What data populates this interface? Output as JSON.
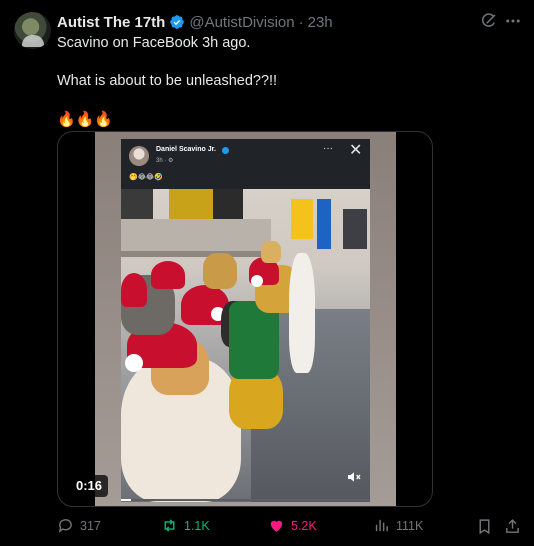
{
  "author": {
    "display_name": "Autist The 17th",
    "handle": "@AutistDivision",
    "separator": "·",
    "time": "23h",
    "verified": true
  },
  "tweet": {
    "line1": "Scavino on FaceBook 3h ago.",
    "line2": "What is about to be unleashed??!!",
    "line3": "🔥🔥🔥"
  },
  "video": {
    "duration": "0:16",
    "progress": 0.04,
    "fb_post": {
      "name": "Daniel Scavino Jr.",
      "time": "3h · ⚙",
      "more": "···",
      "close": "✕",
      "emojis": "🤭😂😂🤣"
    }
  },
  "actions": {
    "replies": "317",
    "reposts": "1.1K",
    "likes": "5.2K",
    "views": "111K"
  },
  "colors": {
    "accent_blue": "#1d9bf0",
    "repost_green": "#00ba7c",
    "like_pink": "#f91880",
    "muted": "#71767b"
  },
  "icons": [
    "verified-icon",
    "grok-icon",
    "more-icon",
    "mute-icon",
    "reply-icon",
    "repost-icon",
    "like-icon",
    "views-icon",
    "bookmark-icon",
    "share-icon"
  ]
}
